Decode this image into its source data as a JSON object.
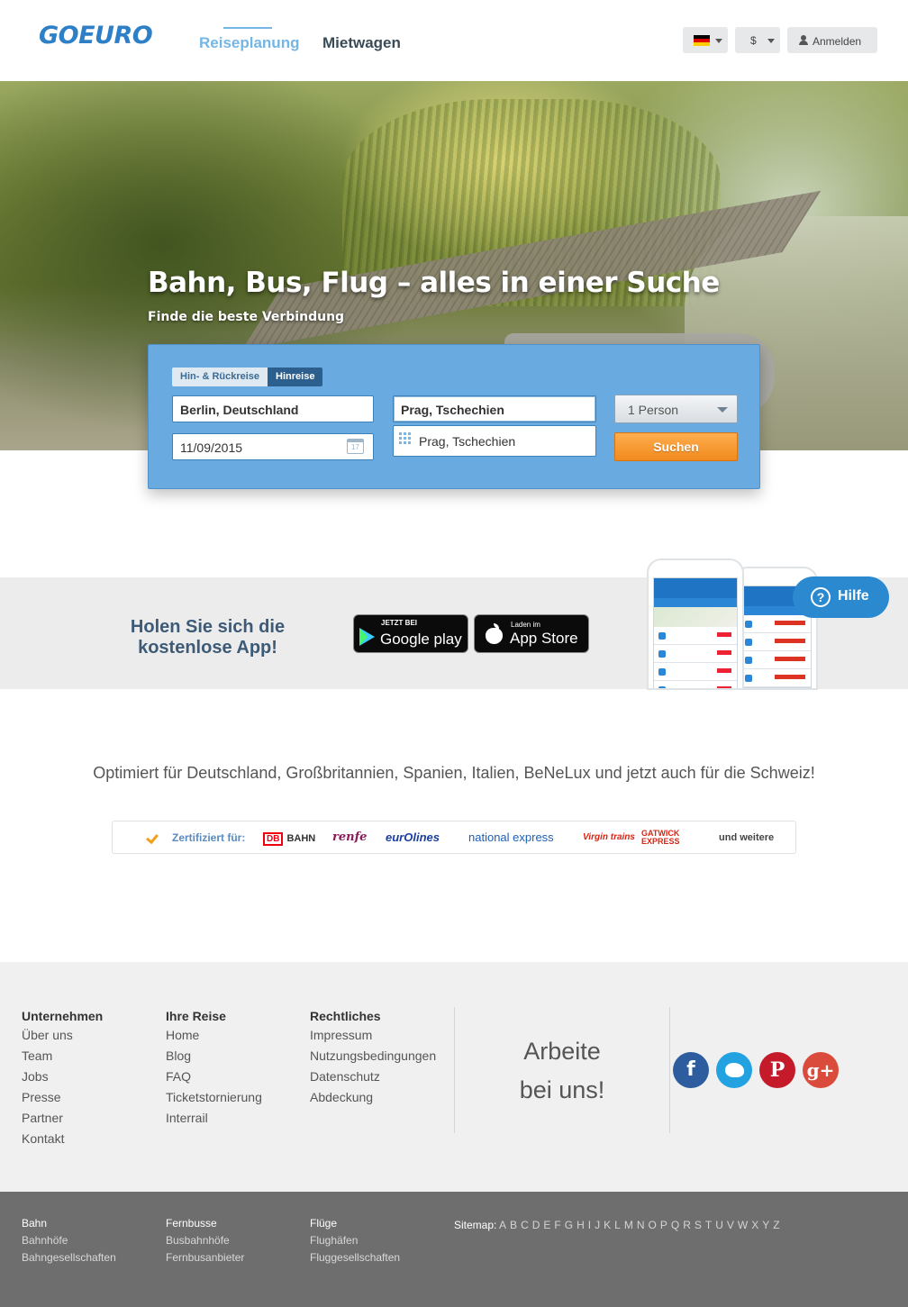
{
  "header": {
    "logo": "GOEURO",
    "nav": [
      "Reiseplanung",
      "Mietwagen"
    ],
    "currency": "$",
    "login": "Anmelden"
  },
  "hero": {
    "title": "Bahn, Bus, Flug – alles in einer Suche",
    "subtitle": "Finde die beste Verbindung"
  },
  "search": {
    "trip_round": "Hin- & Rückreise",
    "trip_oneway": "Hinreise",
    "from": "Berlin, Deutschland",
    "to": "Prag, Tschechien",
    "suggestion": "Prag, Tschechien",
    "date": "11/09/2015",
    "calendar_day": "17",
    "persons": "1 Person",
    "submit": "Suchen"
  },
  "app": {
    "text_line1": "Holen Sie sich die",
    "text_line2": "kostenlose App!",
    "google_small": "JETZT BEI",
    "google_big": "Google play",
    "apple_small": "Laden im",
    "apple_big": "App Store"
  },
  "help": {
    "label": "Hilfe",
    "icon_text": "?"
  },
  "optimized_text": "Optimiert für Deutschland, Großbritannien, Spanien, Italien, BeNeLux und jetzt auch für die Schweiz!",
  "certified": {
    "label": "Zertifiziert für:",
    "partners": {
      "db_mark": "DB",
      "db": "BAHN",
      "renfe": "renfe",
      "eurolines": "eurOlines",
      "national": "national express",
      "virgin": "Virgin trains",
      "gatwick_1": "GATWICK",
      "gatwick_2": "EXPRESS"
    },
    "more": "und weitere"
  },
  "footer": {
    "columns": [
      {
        "title": "Unternehmen",
        "items": [
          "Über uns",
          "Team",
          "Jobs",
          "Presse",
          "Partner",
          "Kontakt"
        ]
      },
      {
        "title": "Ihre Reise",
        "items": [
          "Home",
          "Blog",
          "FAQ",
          "Ticketstornierung",
          "Interrail"
        ]
      },
      {
        "title": "Rechtliches",
        "items": [
          "Impressum",
          "Nutzungsbedingungen",
          "Datenschutz",
          "Abdeckung"
        ]
      }
    ],
    "jobs_line1": "Arbeite",
    "jobs_line2": "bei uns!",
    "social": {
      "facebook": "f",
      "pinterest": "P",
      "googleplus": "g+"
    }
  },
  "subfooter": {
    "columns": [
      {
        "title": "Bahn",
        "items": [
          "Bahnhöfe",
          "Bahngesellschaften"
        ]
      },
      {
        "title": "Fernbusse",
        "items": [
          "Busbahnhöfe",
          "Fernbusanbieter"
        ]
      },
      {
        "title": "Flüge",
        "items": [
          "Flughäfen",
          "Fluggesellschaften"
        ]
      }
    ],
    "sitemap_label": "Sitemap:",
    "letters": [
      "A",
      "B",
      "C",
      "D",
      "E",
      "F",
      "G",
      "H",
      "I",
      "J",
      "K",
      "L",
      "M",
      "N",
      "O",
      "P",
      "Q",
      "R",
      "S",
      "T",
      "U",
      "V",
      "W",
      "X",
      "Y",
      "Z"
    ]
  },
  "colors": {
    "brand_blue": "#2d7fc7",
    "search_bg": "#69abe0",
    "search_button": "#f08a1d",
    "footer_bg": "#f0f0f0",
    "subfooter_bg": "#6e6e6e"
  }
}
